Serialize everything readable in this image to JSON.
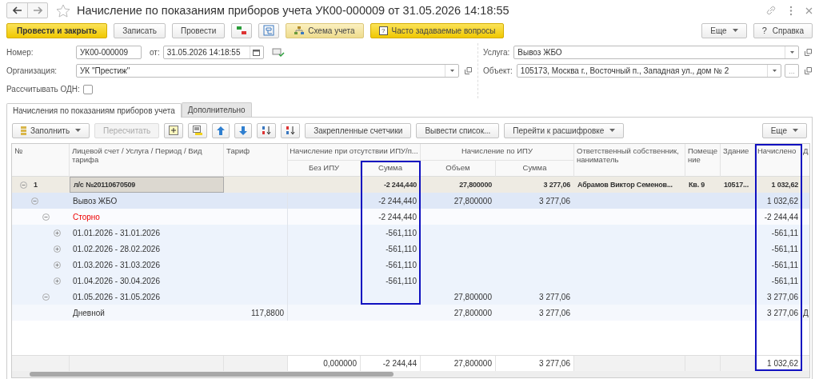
{
  "window": {
    "title": "Начисление по показаниям приборов учета УК00-000009 от 31.05.2026 14:18:55"
  },
  "toolbar": {
    "post_close": "Провести и закрыть",
    "save": "Записать",
    "post": "Провести",
    "scheme": "Схема учета",
    "faq_mark": "?",
    "faq": "Часто задаваемые вопросы",
    "more": "Еще",
    "help_mark": "?",
    "help": "Справка"
  },
  "form": {
    "number_label": "Номер:",
    "number": "УК00-000009",
    "date_label": "от:",
    "date": "31.05.2026 14:18:55",
    "org_label": "Организация:",
    "org": "УК \"Престиж\"",
    "odn_label": "Рассчитывать ОДН:",
    "odn_checked": false,
    "service_label": "Услуга:",
    "service": "Вывоз ЖБО",
    "object_label": "Объект:",
    "object": "105173, Москва г., Восточный п., Западная ул., дом № 2",
    "object_select": "..."
  },
  "tabs": [
    {
      "label": "Начисления по показаниям приборов учета",
      "selected": true
    },
    {
      "label": "Дополнительно",
      "selected": false
    }
  ],
  "table_toolbar": {
    "fill": "Заполнить",
    "recalc": {
      "label": "Пересчитать",
      "disabled": true
    },
    "pinned": "Закрепленные счетчики",
    "print_list": "Вывести список...",
    "drilldown": "Перейти к расшифровке",
    "more": "Еще"
  },
  "table": {
    "columns": [
      {
        "label": "№",
        "highlighted": false
      },
      {
        "label": "Лицевой счет / Услуга / Период / Вид тарифа",
        "highlighted": false
      },
      {
        "label": "Тариф",
        "highlighted": false
      },
      {
        "label": "Начисление при отсутствии ИПУ/п...",
        "children": [
          {
            "label": "Без ИПУ",
            "highlighted": false
          },
          {
            "label": "Сумма",
            "highlighted": true
          }
        ]
      },
      {
        "label": "Начисление по ИПУ",
        "children": [
          {
            "label": "Объем",
            "highlighted": false
          },
          {
            "label": "Сумма",
            "highlighted": false
          }
        ]
      },
      {
        "label": "Ответственный собственник, наниматель",
        "highlighted": false
      },
      {
        "label": "Помещение",
        "highlighted": false
      },
      {
        "label": "Здание",
        "highlighted": false
      },
      {
        "label": "Начислено",
        "highlighted": true
      },
      {
        "label": "Д",
        "highlighted": false
      }
    ],
    "rows": [
      {
        "kind": "account",
        "selected": true,
        "expanded": true,
        "number": "1",
        "name": "л/с №20110670509",
        "sum_no_ipu": "-2 244,440",
        "volume": "27,800000",
        "sum_ipu": "3 277,06",
        "owner": "Абрамов Виктор Семенов...",
        "room": "Кв. 9",
        "building": "10517...",
        "accrued": "1 032,62",
        "children": [
          {
            "kind": "service",
            "selected": false,
            "expanded": true,
            "name": "Вывоз ЖБО",
            "sum_no_ipu": "-2 244,440",
            "volume": "27,800000",
            "sum_ipu": "3 277,06",
            "accrued": "1 032,62",
            "children": [
              {
                "kind": "storno",
                "selected": false,
                "expanded": true,
                "name": "Сторно",
                "sum_no_ipu": "-2 244,440",
                "accrued": "-2 244,44",
                "children": [
                  {
                    "kind": "period",
                    "selected": false,
                    "expanded": false,
                    "name": "01.01.2026 - 31.01.2026",
                    "sum_no_ipu": "-561,110",
                    "accrued": "-561,11"
                  },
                  {
                    "kind": "period",
                    "selected": false,
                    "expanded": false,
                    "name": "01.02.2026 - 28.02.2026",
                    "sum_no_ipu": "-561,110",
                    "accrued": "-561,11"
                  },
                  {
                    "kind": "period",
                    "selected": false,
                    "expanded": false,
                    "name": "01.03.2026 - 31.03.2026",
                    "sum_no_ipu": "-561,110",
                    "accrued": "-561,11"
                  },
                  {
                    "kind": "period",
                    "selected": false,
                    "expanded": false,
                    "name": "01.04.2026 - 30.04.2026",
                    "sum_no_ipu": "-561,110",
                    "accrued": "-561,11"
                  }
                ]
              },
              {
                "kind": "period",
                "selected": false,
                "expanded": true,
                "name": "01.05.2026 - 31.05.2026",
                "volume": "27,800000",
                "sum_ipu": "3 277,06",
                "accrued": "3 277,06",
                "children": [
                  {
                    "kind": "tariff",
                    "selected": false,
                    "name": "Дневной",
                    "tariff": "117,8800",
                    "volume": "27,800000",
                    "sum_ipu": "3 277,06",
                    "accrued": "3 277,06",
                    "column_12": "Д"
                  }
                ]
              }
            ]
          }
        ]
      }
    ],
    "totals": {
      "no_ipu": "0,000000",
      "sum_no_ipu": "-2 244,44",
      "volume": "27,800000",
      "sum_ipu": "3 277,06",
      "accrued": "1 032,62"
    }
  }
}
